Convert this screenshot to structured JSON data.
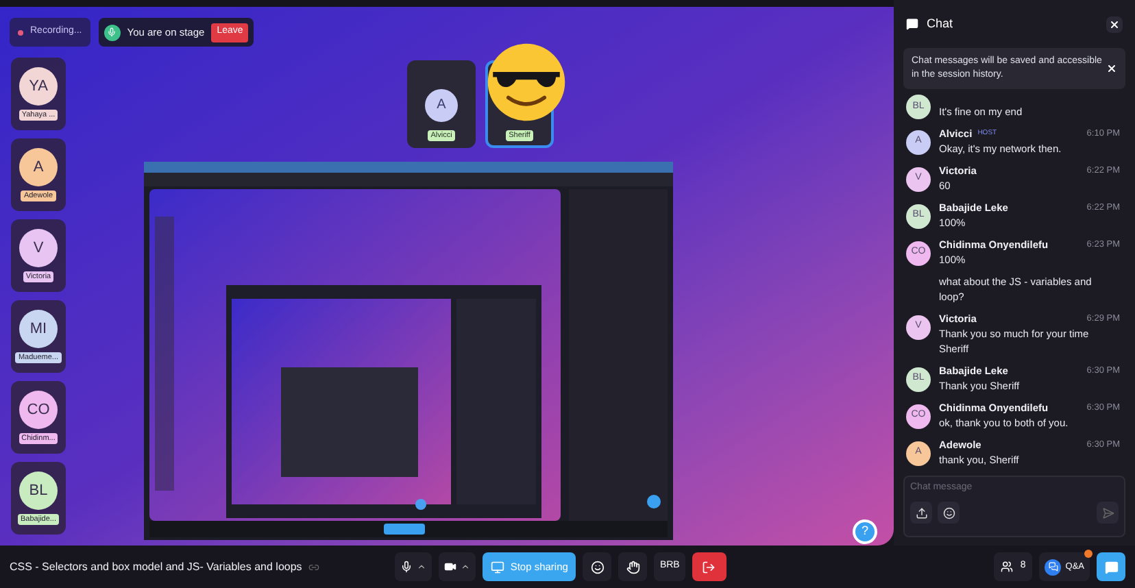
{
  "recording": {
    "label": "Recording...",
    "on": true
  },
  "stage_notice": {
    "text": "You are on stage",
    "button": "Leave"
  },
  "sidebar": {
    "participants": [
      {
        "initials": "YA",
        "name": "Yahaya ...",
        "color": "#f2d6d6"
      },
      {
        "initials": "A",
        "name": "Adewole",
        "color": "#f7c79a"
      },
      {
        "initials": "V",
        "name": "Victoria",
        "color": "#e8c4f2"
      },
      {
        "initials": "MI",
        "name": "Madueme...",
        "color": "#c9d6f2"
      },
      {
        "initials": "CO",
        "name": "Chidinm...",
        "color": "#efb8ee"
      },
      {
        "initials": "BL",
        "name": "Babajide...",
        "color": "#c8ecc0"
      }
    ]
  },
  "stage": {
    "speakers": [
      {
        "initials": "A",
        "name": "Alvicci",
        "kind": "avatar",
        "selected": false
      },
      {
        "name": "Sheriff",
        "kind": "emoji",
        "selected": true
      }
    ],
    "help": "?"
  },
  "chat": {
    "title": "Chat",
    "notice": "Chat messages will be saved and accessible in the session history.",
    "messages": [
      {
        "kind": "cut",
        "initials": "BL",
        "color": "#cfe8cf",
        "text": "It's fine on my end"
      },
      {
        "kind": "message",
        "initials": "A",
        "color": "#c9cdf5",
        "name": "Alvicci",
        "badge": "HOST",
        "time": "6:10 PM",
        "text": "Okay, it's my network then."
      },
      {
        "kind": "message",
        "initials": "V",
        "color": "#ecc4f0",
        "name": "Victoria",
        "time": "6:22 PM",
        "text": "60"
      },
      {
        "kind": "message",
        "initials": "BL",
        "color": "#cfe8cf",
        "name": "Babajide Leke",
        "time": "6:22 PM",
        "text": "100%"
      },
      {
        "kind": "message",
        "initials": "CO",
        "color": "#efb8ee",
        "name": "Chidinma Onyendilefu",
        "time": "6:23 PM",
        "text": "100%"
      },
      {
        "kind": "continuation",
        "text": "what about the JS - variables and loop?"
      },
      {
        "kind": "message",
        "initials": "V",
        "color": "#ecc4f0",
        "name": "Victoria",
        "time": "6:29 PM",
        "text": "Thank you so much for your time Sheriff"
      },
      {
        "kind": "message",
        "initials": "BL",
        "color": "#cfe8cf",
        "name": "Babajide Leke",
        "time": "6:30 PM",
        "text": "Thank you Sheriff"
      },
      {
        "kind": "message",
        "initials": "CO",
        "color": "#efb8ee",
        "name": "Chidinma Onyendilefu",
        "time": "6:30 PM",
        "text": "ok, thank you to both of you."
      },
      {
        "kind": "message",
        "initials": "A",
        "color": "#f7c79a",
        "name": "Adewole",
        "time": "6:30 PM",
        "text": "thank you, Sheriff"
      }
    ],
    "input": {
      "placeholder": "Chat message"
    }
  },
  "bottom_bar": {
    "title": "CSS - Selectors and box model and JS- Variables and loops",
    "stop_sharing": "Stop sharing",
    "brb": "BRB",
    "people_count": "8",
    "qa": "Q&A",
    "qa_unread": true,
    "chat_open": true
  }
}
